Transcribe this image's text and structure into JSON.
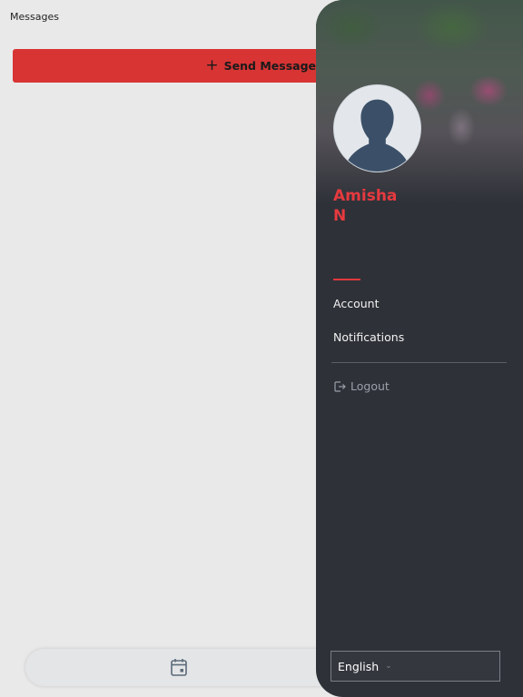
{
  "page": {
    "title": "Messages"
  },
  "actions": {
    "send_message_label": "Send Message",
    "send_message_icon": "plus-icon"
  },
  "bottom_nav": {
    "icon": "calendar-icon"
  },
  "drawer": {
    "user_name": "Amisha N",
    "avatar_icon": "person-silhouette-icon",
    "menu": [
      {
        "label": "Account"
      },
      {
        "label": "Notifications"
      }
    ],
    "logout_label": "Logout",
    "logout_icon": "logout-icon",
    "language": {
      "selected": "English"
    }
  },
  "colors": {
    "accent_red": "#d83434",
    "name_red": "#e63a3f",
    "drawer_bg": "#2e3138",
    "page_bg": "#e9e9e9"
  }
}
